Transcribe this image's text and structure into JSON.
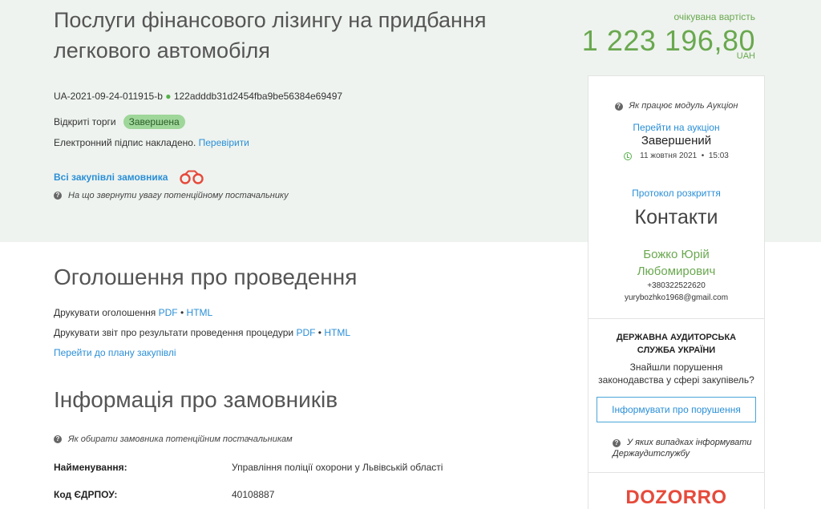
{
  "header": {
    "title": "Послуги фінансового лізингу на придбання легкового автомобіля",
    "value_label": "очікувана вартість",
    "value_amount": "1 223 196,80",
    "value_currency": "UAH"
  },
  "tender": {
    "id": "UA-2021-09-24-011915-b",
    "hash": "122adddb31d2454fba9be56384e69497",
    "procedure": "Відкриті торги",
    "status": "Завершена",
    "signature_text": "Електронний підпис накладено.",
    "signature_link": "Перевірити",
    "buyer_link": "Всі закупівлі замовника",
    "hint": "На що звернути увагу потенційному постачальнику"
  },
  "announcement": {
    "title": "Оголошення про проведення",
    "print_announcement": "Друкувати оголошення",
    "print_report": "Друкувати звіт про результати проведення процедури",
    "pdf": "PDF",
    "html": "HTML",
    "separator": "•",
    "plan_link": "Перейти до плану закупівлі"
  },
  "buyers": {
    "title": "Інформація про замовників",
    "hint": "Як обирати замовника потенційним постачальникам",
    "rows": [
      {
        "key": "Найменування:",
        "value": "Управління поліції охорони у Львівській області"
      },
      {
        "key": "Код ЄДРПОУ:",
        "value": "40108887"
      }
    ]
  },
  "sidebar": {
    "auction_help": "Як працює модуль Аукціон",
    "auction_link": "Перейти на аукціон",
    "auction_status": "Завершений",
    "auction_date": "11 жовтня 2021",
    "auction_time": "15:03",
    "protocol_link": "Протокол розкриття",
    "contacts_title": "Контакти",
    "contact_name_1": "Божко Юрій",
    "contact_name_2": "Любомирович",
    "contact_phone": "+380322522620",
    "contact_email": "yurybozhko1968@gmail.com",
    "audit_title_1": "ДЕРЖАВНА АУДИТОРСЬКА",
    "audit_title_2": "СЛУЖБА УКРАЇНИ",
    "audit_question_1": "Знайшли порушення",
    "audit_question_2": "законодавства у сфері закупівель?",
    "report_button": "Інформувати про порушення",
    "when_to_report": "У яких випадках інформувати Держаудитслужбу",
    "logo_text": "DOZORRO"
  },
  "colors": {
    "hero_bg": "#eef3ef",
    "accent_green": "#6aa84f",
    "link_blue": "#2a8fd7",
    "badge_green": "#9fd69a",
    "logo_red": "#e64a3b"
  },
  "icons": {
    "question": "question-circle-icon",
    "binoculars": "binoculars-icon",
    "clock": "clock-icon"
  }
}
